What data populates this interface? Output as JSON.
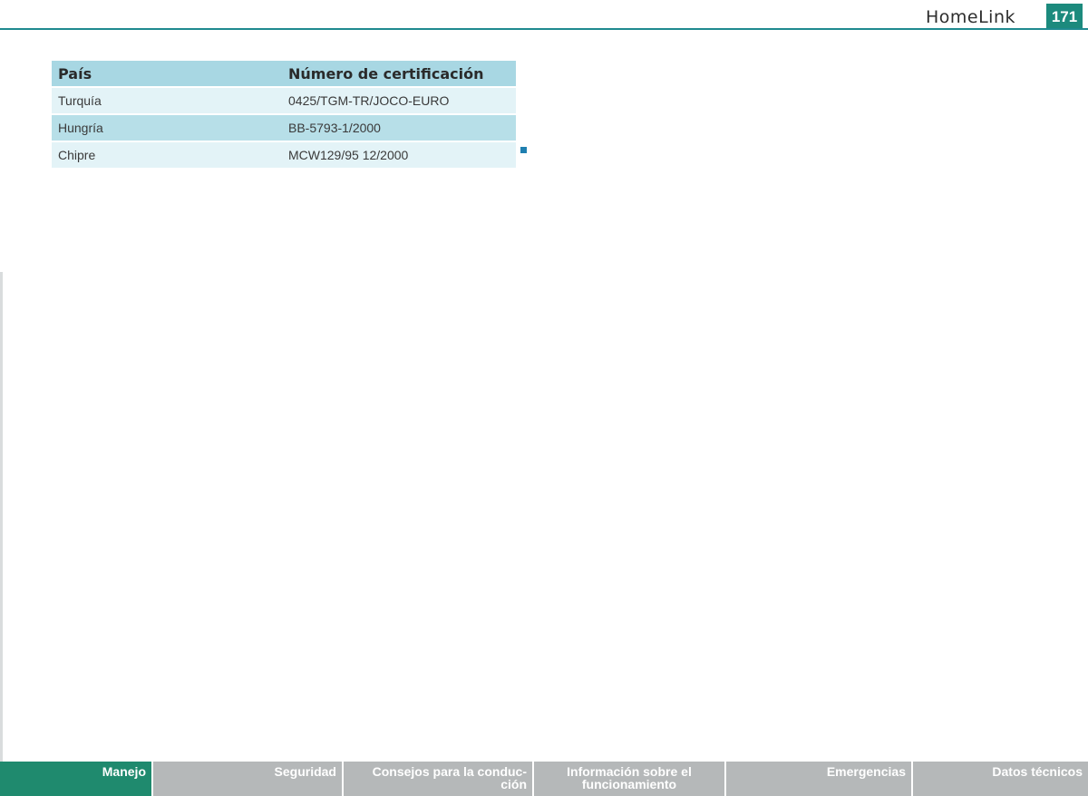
{
  "header": {
    "running_title": "HomeLink",
    "page_number": "171"
  },
  "table": {
    "columns": [
      "País",
      "Número de certificación"
    ],
    "rows": [
      {
        "country": "Turquía",
        "certificate": "0425/TGM-TR/JOCO-EURO"
      },
      {
        "country": "Hungría",
        "certificate": "BB-5793-1/2000"
      },
      {
        "country": "Chipre",
        "certificate": "MCW129/95 12/2000"
      }
    ]
  },
  "footer": {
    "tabs": [
      {
        "label": "Manejo"
      },
      {
        "label": "Seguridad"
      },
      {
        "label": "Consejos para la conduc-\nción"
      },
      {
        "label": "Información sobre el\nfuncionamiento"
      },
      {
        "label": "Emergencias"
      },
      {
        "label": "Datos técnicos"
      }
    ]
  },
  "colors": {
    "accent": "#1f8a8f",
    "active_tab": "#1f8a6e",
    "inactive_tab": "#b5b8b9",
    "table_header": "#a8d7e3"
  }
}
